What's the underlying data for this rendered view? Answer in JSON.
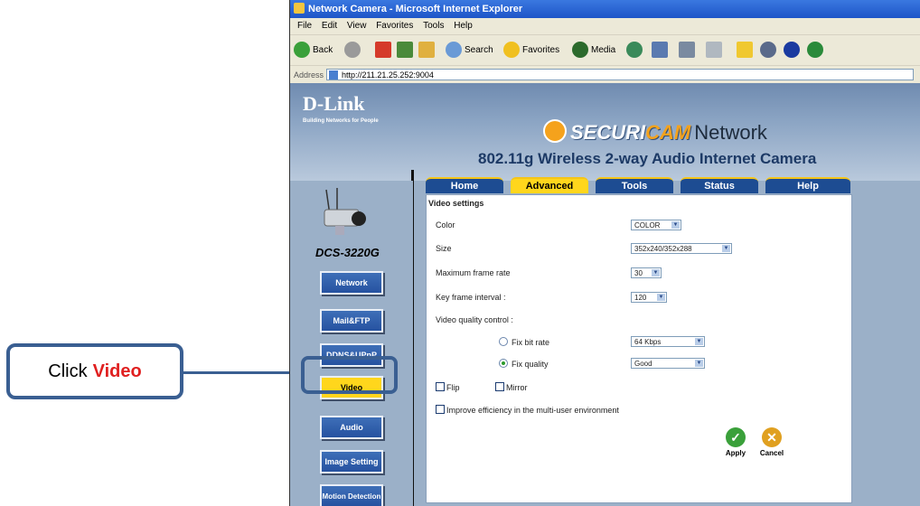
{
  "callout": {
    "prefix": "Click",
    "highlight": "Video"
  },
  "browser": {
    "title": "Network Camera - Microsoft Internet Explorer",
    "menu": [
      "File",
      "Edit",
      "View",
      "Favorites",
      "Tools",
      "Help"
    ],
    "toolbar": {
      "back": "Back",
      "search": "Search",
      "favorites": "Favorites",
      "media": "Media"
    },
    "address_label": "Address",
    "address": "http://211.21.25.252:9004"
  },
  "header": {
    "brand": "D-Link",
    "brand_tagline": "Building Networks for People",
    "product_line_a": "SECURI",
    "product_line_b": "CAM",
    "product_line_c": "Network",
    "subtitle": "802.11g Wireless 2-way Audio Internet Camera"
  },
  "sidebar": {
    "model": "DCS-3220G",
    "items": [
      "Network",
      "Mail&FTP",
      "DDNS&UPnP",
      "Video",
      "Audio",
      "Image Setting",
      "Motion Detection"
    ],
    "active": "Video"
  },
  "tabs": [
    "Home",
    "Advanced",
    "Tools",
    "Status",
    "Help"
  ],
  "active_tab": "Advanced",
  "settings": {
    "section_title": "Video settings",
    "color_label": "Color",
    "color_value": "COLOR",
    "size_label": "Size",
    "size_value": "352x240/352x288",
    "max_fps_label": "Maximum frame rate",
    "max_fps_value": "30",
    "keyframe_label": "Key frame interval :",
    "keyframe_value": "120",
    "quality_label": "Video quality control :",
    "fix_bitrate_label": "Fix bit rate",
    "fix_bitrate_value": "64 Kbps",
    "fix_quality_label": "Fix quality",
    "fix_quality_value": "Good",
    "flip_label": "Flip",
    "mirror_label": "Mirror",
    "multiuser_label": "Improve efficiency in the multi-user environment",
    "apply_label": "Apply",
    "cancel_label": "Cancel"
  },
  "colors": {
    "nav_blue": "#2652a0",
    "active_yellow": "#ffd61c",
    "callout_border": "#3a5f92",
    "callout_red": "#e02020"
  }
}
